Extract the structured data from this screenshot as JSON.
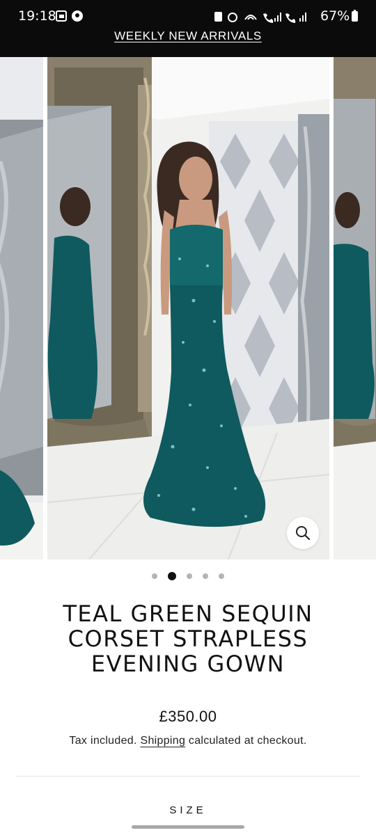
{
  "status_bar": {
    "time": "19:18",
    "battery": "67%"
  },
  "announcement": "WEEKLY NEW ARRIVALS",
  "gallery": {
    "slide_count": 5,
    "active_slide": 2,
    "zoom_icon": "search-icon"
  },
  "product": {
    "title": "TEAL GREEN SEQUIN CORSET STRAPLESS EVENING GOWN",
    "price": "£350.00",
    "tax_prefix": "Tax included.",
    "shipping_link": "Shipping",
    "tax_suffix": "calculated at checkout."
  },
  "options": {
    "size_label": "SIZE"
  },
  "colors": {
    "gown": "#0f5a5e",
    "background_bar": "#0b0b0b"
  }
}
